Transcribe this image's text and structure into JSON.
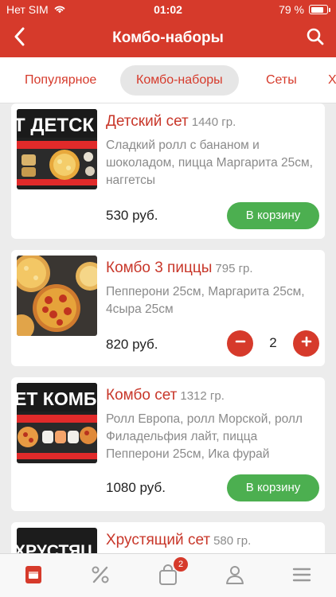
{
  "status_bar": {
    "carrier": "Нет SIM",
    "time": "01:02",
    "battery": "79 %",
    "battery_level": 0.79
  },
  "nav": {
    "title": "Комбо-наборы"
  },
  "tabs": [
    {
      "label": "Популярное",
      "active": false
    },
    {
      "label": "Комбо-наборы",
      "active": true
    },
    {
      "label": "Сеты",
      "active": false
    },
    {
      "label": "Х",
      "active": false
    }
  ],
  "products": [
    {
      "name": "Детский сет",
      "weight": "1440 гр.",
      "description": "Сладкий ролл с бананом и шоколадом, пицца Маргарита 25см, наггетсы",
      "price": "530 руб.",
      "cart_label": "В корзину",
      "banner_text": "Т ДЕТСК"
    },
    {
      "name": "Комбо 3 пиццы",
      "weight": "795 гр.",
      "description": "Пепперони 25см, Маргарита 25см, 4сыра 25см",
      "price": "820 руб.",
      "quantity": "2"
    },
    {
      "name": "Комбо сет",
      "weight": "1312 гр.",
      "description": "Ролл Европа, ролл Морской, ролл Филадельфия лайт, пицца Пепперони 25см, Ика фурай",
      "price": "1080 руб.",
      "cart_label": "В корзину",
      "banner_text": "ЕТ КОМБ"
    },
    {
      "name": "Хрустящий сет",
      "weight": "580 гр.",
      "banner_text": "ХРУСТЯЦ"
    }
  ],
  "tabbar": {
    "cart_badge": "2"
  },
  "colors": {
    "primary": "#d63a2b",
    "accent_green": "#4caf50",
    "text_muted": "#8a8a8a"
  }
}
